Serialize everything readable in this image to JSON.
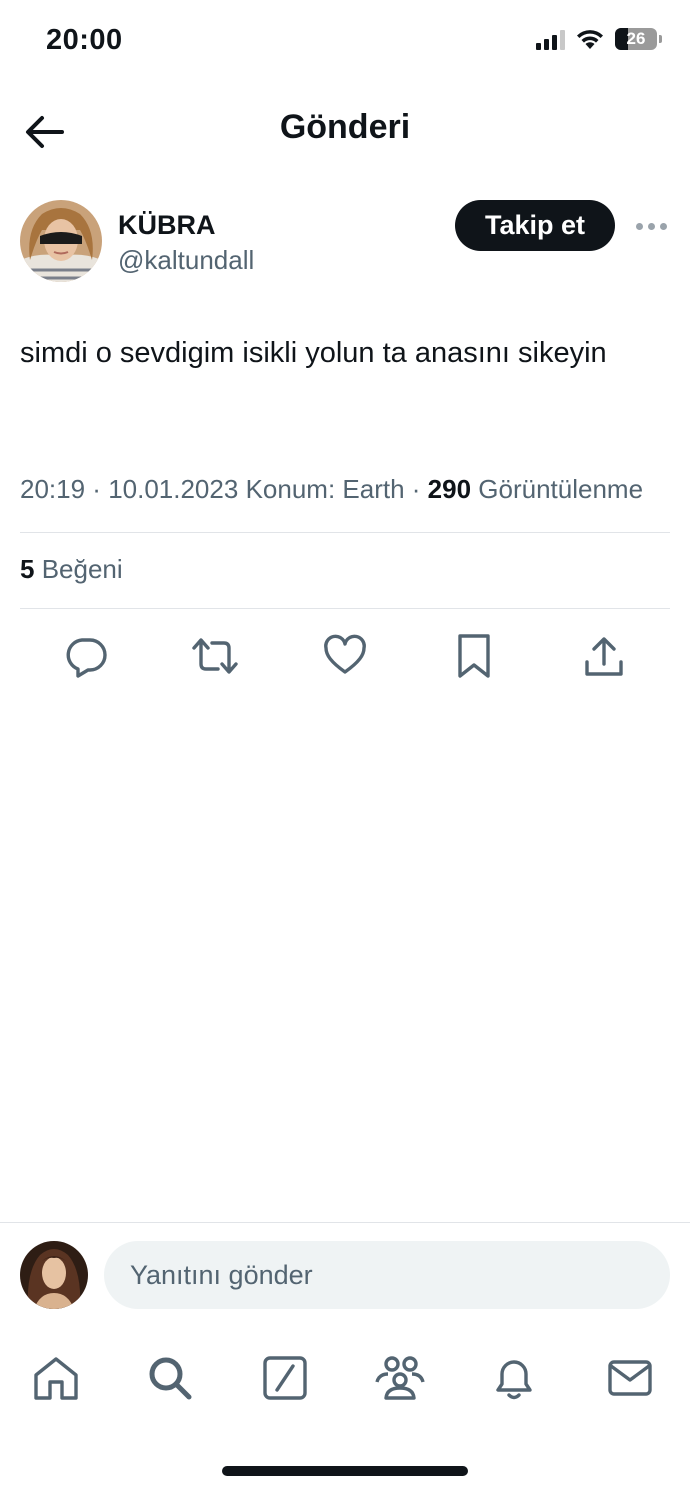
{
  "status_bar": {
    "time": "20:00",
    "battery": "26"
  },
  "header": {
    "title": "Gönderi"
  },
  "tweet": {
    "author_name": "KÜBRA",
    "author_handle": "@kaltundall",
    "follow_label": "Takip et",
    "text": "simdi o sevdigim isikli yolun ta anasını sikeyin",
    "time": "20:19",
    "date": "10.01.2023",
    "location": "Konum: Earth",
    "views_count": "290",
    "views_label": "Görüntülenme",
    "likes_count": "5",
    "likes_label": "Beğeni"
  },
  "reply": {
    "placeholder": "Yanıtını gönder"
  },
  "icons": {
    "back": "arrow-left-icon",
    "more": "more-horizontal-icon",
    "actions": [
      "reply-icon",
      "retweet-icon",
      "like-icon",
      "bookmark-icon",
      "share-icon"
    ],
    "tabs": [
      "home-icon",
      "search-icon",
      "compose-icon",
      "communities-icon",
      "notifications-icon",
      "messages-icon"
    ]
  },
  "colors": {
    "text": "#0f1419",
    "secondary": "#536471",
    "divider": "#e1e4e8",
    "input_bg": "#eff3f4"
  }
}
